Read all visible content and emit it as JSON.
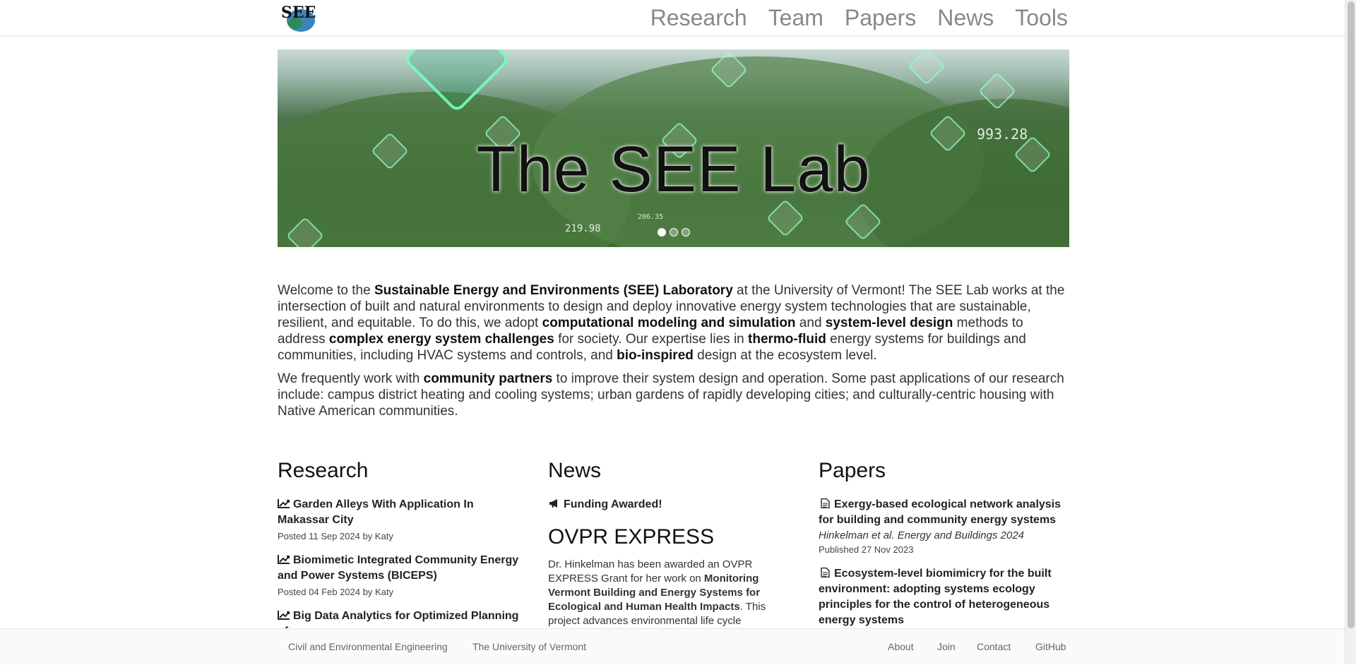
{
  "header": {
    "logo_text": "SEE",
    "nav": [
      "Research",
      "Team",
      "Papers",
      "News",
      "Tools"
    ]
  },
  "hero": {
    "title": "The SEE Lab",
    "overlay_number_right": "993.28",
    "overlay_number_left": "219.98",
    "overlay_number_small": "206.35",
    "slides_total": 3,
    "slide_active": 1
  },
  "intro": {
    "p1": [
      {
        "t": "Welcome to the ",
        "b": false
      },
      {
        "t": "Sustainable Energy and Environments (SEE) Laboratory",
        "b": true
      },
      {
        "t": " at the University of Vermont! The SEE Lab works at the intersection of built and natural environments to design and deploy innovative energy system technologies that are sustainable, resilient, and equitable. To do this, we adopt ",
        "b": false
      },
      {
        "t": "computational modeling and simulation",
        "b": true
      },
      {
        "t": " and ",
        "b": false
      },
      {
        "t": "system-level design",
        "b": true
      },
      {
        "t": " methods to address ",
        "b": false
      },
      {
        "t": "complex energy system challenges",
        "b": true
      },
      {
        "t": " for society. Our expertise lies in ",
        "b": false
      },
      {
        "t": "thermo-fluid",
        "b": true
      },
      {
        "t": " energy systems for buildings and communities, including HVAC systems and controls, and ",
        "b": false
      },
      {
        "t": "bio-inspired",
        "b": true
      },
      {
        "t": " design at the ecosystem level.",
        "b": false
      }
    ],
    "p2": [
      {
        "t": "We frequently work with ",
        "b": false
      },
      {
        "t": "community partners",
        "b": true
      },
      {
        "t": " to improve their system design and operation. Some past applications of our research include: campus district heating and cooling systems; urban gardens of rapidly developing cities; and culturally-centric housing with Native American communities.",
        "b": false
      }
    ]
  },
  "research": {
    "heading": "Research",
    "items": [
      {
        "title": "Garden Alleys With Application In Makassar City",
        "meta": "Posted 11 Sep 2024 by Katy"
      },
      {
        "title": "Biomimetic Integrated Community Energy and Power Systems (BICEPS)",
        "meta": "Posted 04 Feb 2024 by Katy"
      },
      {
        "title": "Big Data Analytics for Optimized Planning of",
        "meta": ""
      }
    ]
  },
  "news": {
    "heading": "News",
    "item_title": "Funding Awarded!",
    "post_heading": "OVPR EXPRESS",
    "body_parts": [
      {
        "t": "Dr. Hinkelman has been awarded an OVPR EXPRESS Grant for her work on ",
        "b": false
      },
      {
        "t": "Monitoring Vermont Building and Energy Systems for Ecological and Human Health Impacts",
        "b": true
      },
      {
        "t": ". This project advances environmental life cycle",
        "b": false
      }
    ]
  },
  "papers": {
    "heading": "Papers",
    "items": [
      {
        "title": "Exergy-based ecological network analysis for building and community energy systems",
        "cite": "Hinkelman et al. Energy and Buildings 2024",
        "meta": "Published 27 Nov 2023"
      },
      {
        "title": "Ecosystem-level biomimicry for the built environment: adopting systems ecology principles for the control of heterogeneous energy systems",
        "cite": "",
        "meta": ""
      }
    ]
  },
  "footer": {
    "left": [
      "Civil and Environmental Engineering",
      "The University of Vermont"
    ],
    "right": [
      "About",
      "Join",
      "Contact",
      "GitHub"
    ]
  },
  "colors": {
    "accent_green": "#2f5a29",
    "hex_glow": "#8cffc8"
  }
}
